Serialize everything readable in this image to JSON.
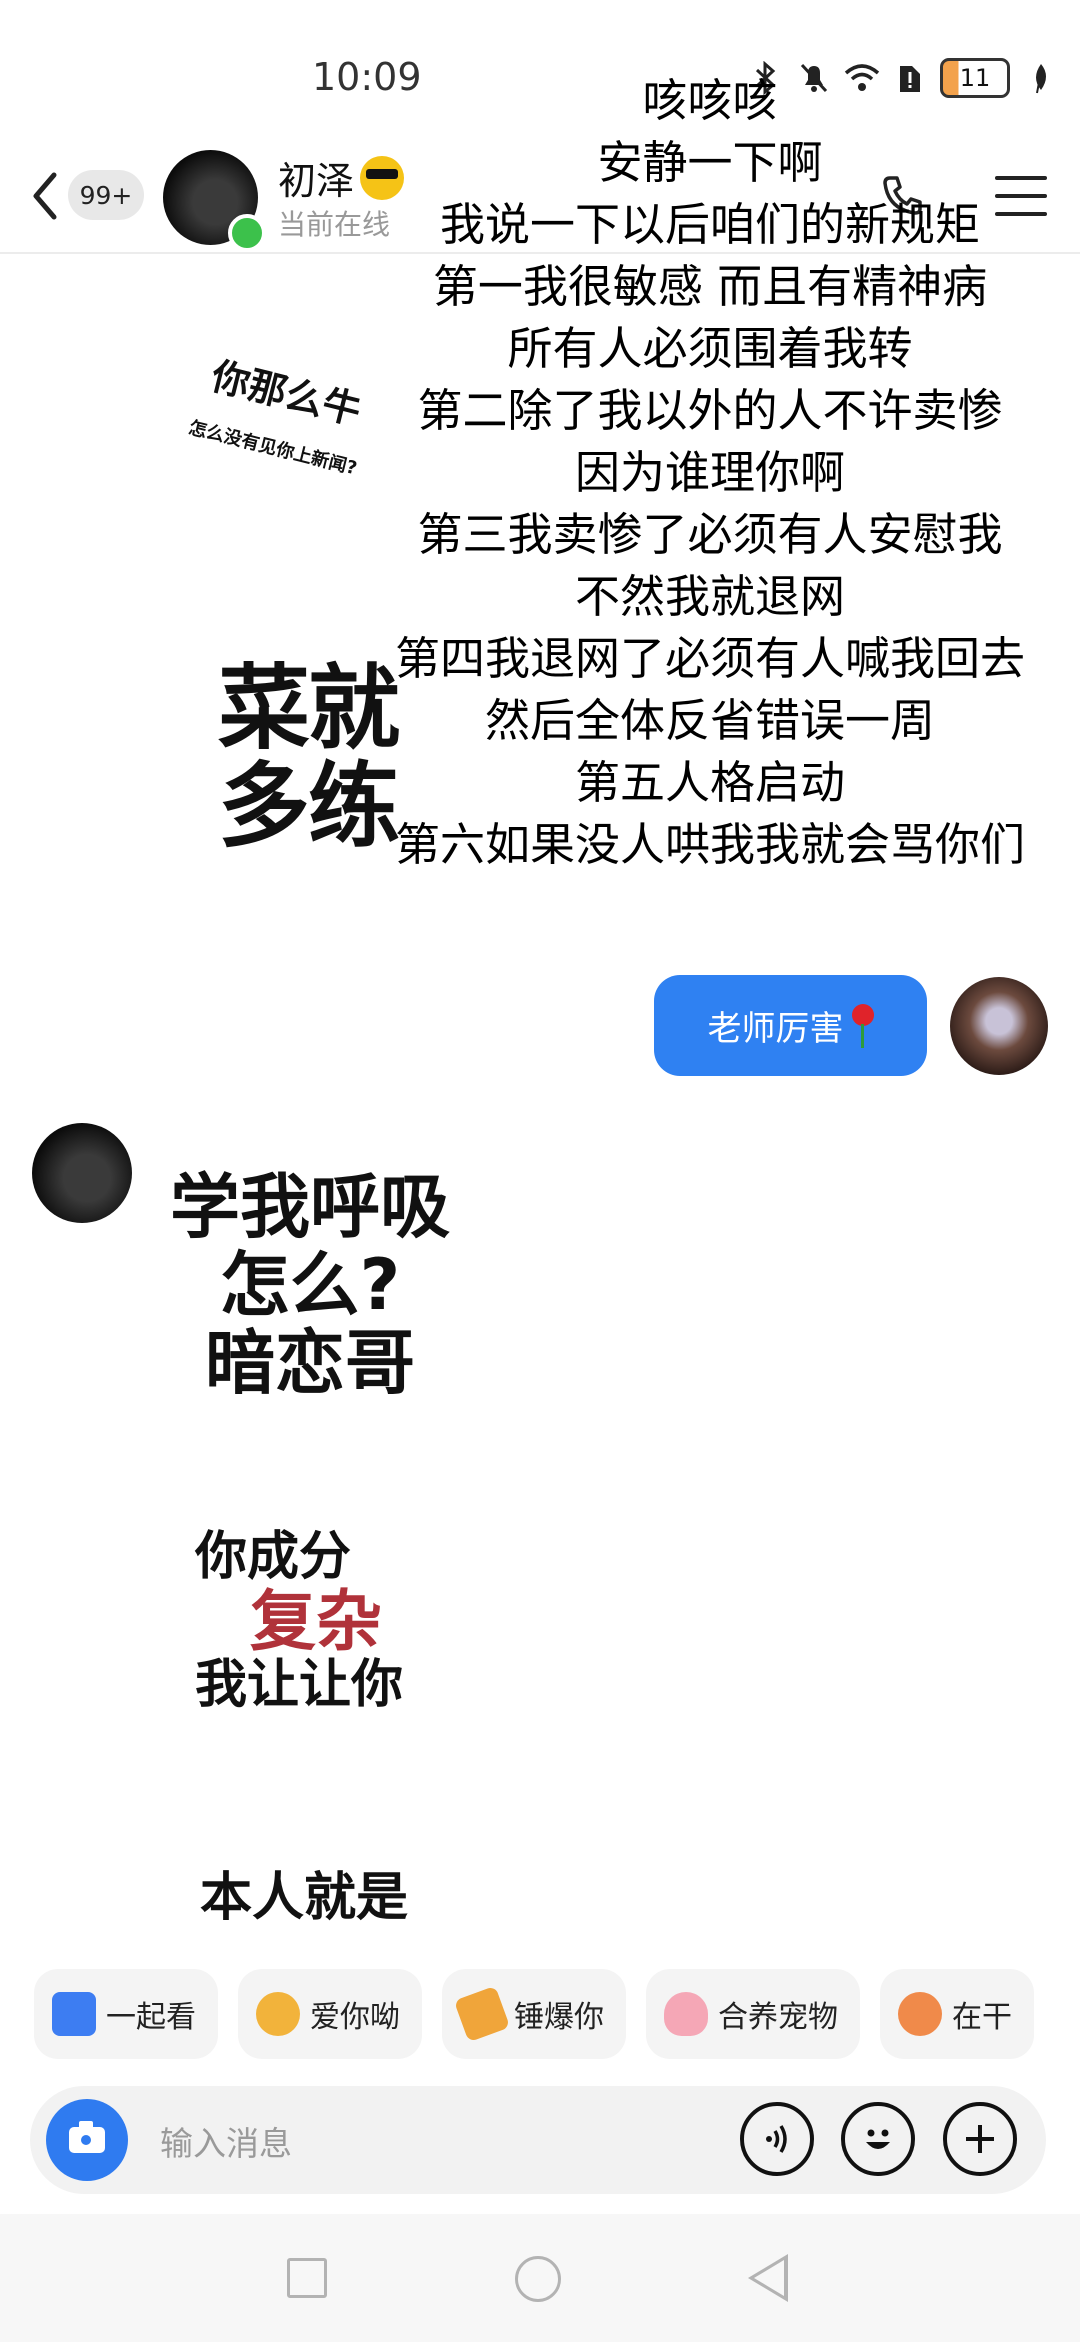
{
  "status_bar": {
    "time": "10:09",
    "battery_level": "11"
  },
  "header": {
    "unread_badge": "99+",
    "contact_name": "初泽",
    "contact_status": "当前在线"
  },
  "overlay_lines": [
    "咳咳咳",
    "安静一下啊",
    "我说一下以后咱们的新规矩",
    "第一我很敏感 而且有精神病",
    "所有人必须围着我转",
    "第二除了我以外的人不许卖惨",
    "因为谁理你啊",
    "第三我卖惨了必须有人安慰我",
    "不然我就退网",
    "第四我退网了必须有人喊我回去",
    "然后全体反省错误一周",
    "第五人格启动",
    "第六如果没人哄我我就会骂你们"
  ],
  "stickers": {
    "s1_big": "你那么牛",
    "s1_small": "怎么没有见你上新闻?",
    "s2_line1": "菜就",
    "s2_line2": "多练",
    "s3_line1": "学我呼吸",
    "s3_line2": "怎么?",
    "s3_line3": "暗恋哥",
    "s4_line1": "你成分",
    "s4_line2": "复杂",
    "s4_line3": "我让让你",
    "s5_line1": "本人就是"
  },
  "messages": {
    "outgoing_text": "老师厉害"
  },
  "quick_actions": [
    {
      "label": "一起看",
      "icon": "watch-together-icon"
    },
    {
      "label": "爱你呦",
      "icon": "love-face-icon"
    },
    {
      "label": "锤爆你",
      "icon": "hammer-icon"
    },
    {
      "label": "合养宠物",
      "icon": "pet-icon"
    },
    {
      "label": "在干",
      "icon": "busy-icon"
    }
  ],
  "input": {
    "placeholder": "输入消息"
  },
  "colors": {
    "accent_blue": "#2f81f2",
    "online_green": "#3cc14b",
    "sticker_red": "#b0323a"
  }
}
